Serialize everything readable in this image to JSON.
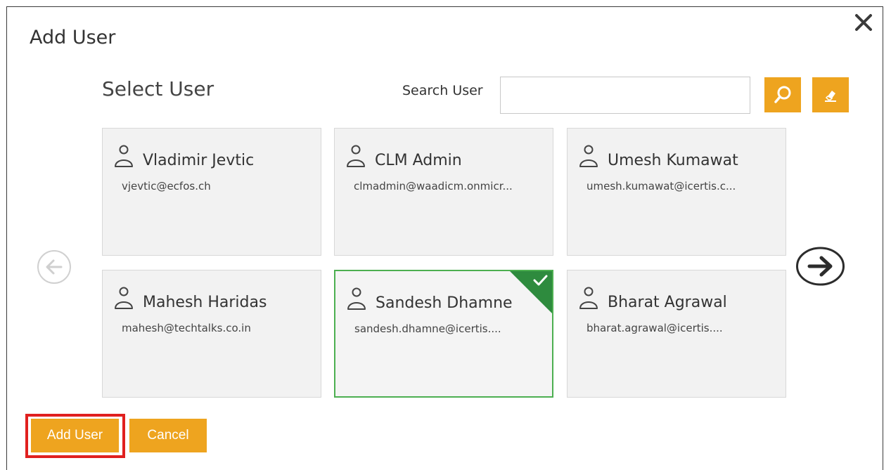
{
  "dialog": {
    "title": "Add User",
    "section_title": "Select User",
    "search_label": "Search User",
    "search_value": "",
    "search_placeholder": ""
  },
  "users": [
    {
      "name": "Vladimir Jevtic",
      "email": "vjevtic@ecfos.ch",
      "selected": false
    },
    {
      "name": "CLM Admin",
      "email": "clmadmin@waadicm.onmicr...",
      "selected": false
    },
    {
      "name": "Umesh Kumawat",
      "email": "umesh.kumawat@icertis.c...",
      "selected": false
    },
    {
      "name": "Mahesh Haridas",
      "email": "mahesh@techtalks.co.in",
      "selected": false
    },
    {
      "name": "Sandesh Dhamne",
      "email": "sandesh.dhamne@icertis....",
      "selected": true
    },
    {
      "name": "Bharat Agrawal",
      "email": "bharat.agrawal@icertis....",
      "selected": false
    }
  ],
  "footer": {
    "add_user_label": "Add User",
    "cancel_label": "Cancel"
  },
  "icons": {
    "close": "close-icon",
    "search": "search-icon",
    "clear": "eraser-icon",
    "user": "user-icon",
    "prev": "arrow-left-icon",
    "next": "arrow-right-icon",
    "check": "checkmark-icon"
  },
  "colors": {
    "accent": "#eea41f",
    "selected_border": "#4caf50",
    "selected_corner": "#2e8b3e",
    "highlight": "#e0201f"
  }
}
